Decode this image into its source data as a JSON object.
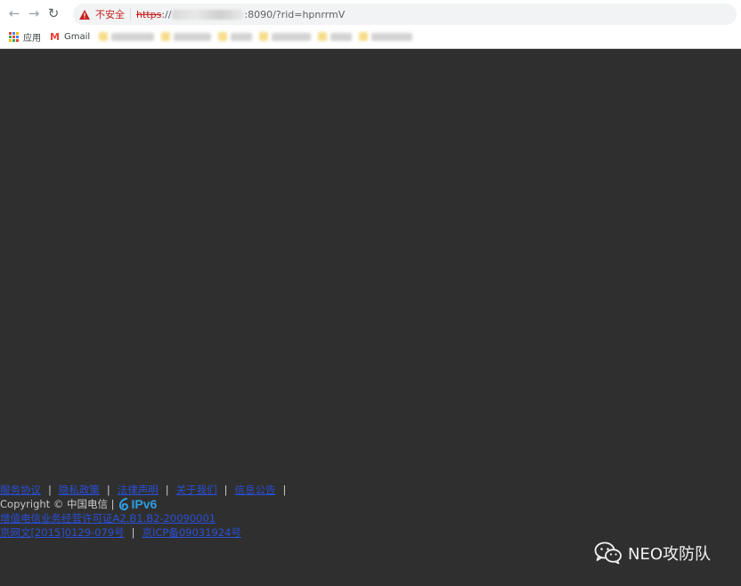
{
  "browser": {
    "insecure_label": "不安全",
    "url_scheme": "https",
    "url_slashes": "://",
    "url_rest": ":8090/?rid=hpnrrmV",
    "bookmarks": {
      "apps_label": "应用",
      "gmail_label": "Gmail"
    }
  },
  "footer": {
    "links_row1": [
      "服务协议",
      "隐私政策",
      "法律声明",
      "关于我们",
      "信息公告"
    ],
    "pipe": "|",
    "copyright": "Copyright © 中国电信 |",
    "ipv6_label": "IPv6",
    "license_line": "增值电信业务经营许可证A2.B1.B2-20090001",
    "icp_links": [
      "京网文[2015]0129-079号",
      "京ICP备09031924号"
    ]
  },
  "watermark": {
    "text": "NEO攻防队"
  },
  "colors": {
    "page_bg": "#2f2f2f",
    "link": "#2a4fd6",
    "insecure": "#c5221f",
    "ipv6": "#2f9de0"
  }
}
